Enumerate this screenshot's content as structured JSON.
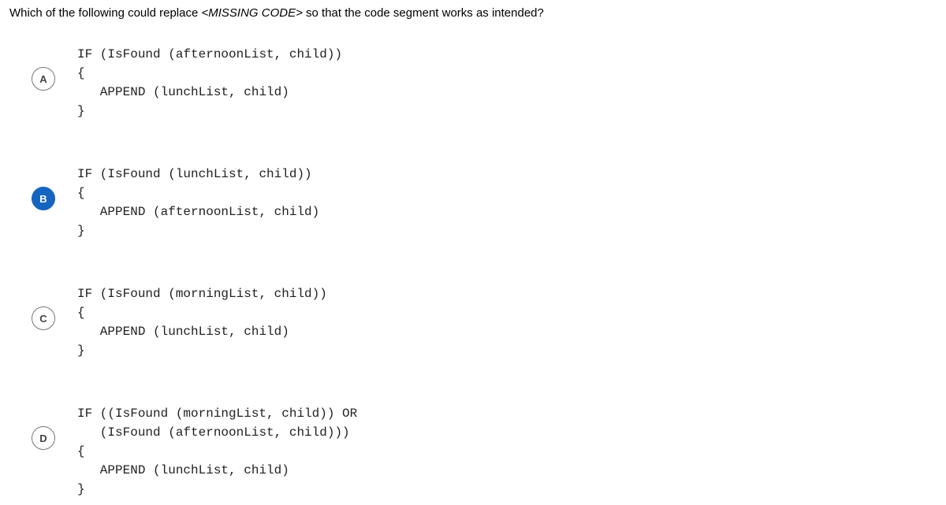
{
  "question_prefix": "Which of the following could replace ",
  "question_code": "<MISSING CODE>",
  "question_suffix": " so that the code segment works as intended?",
  "options": [
    {
      "letter": "A",
      "selected": false,
      "code": "IF (IsFound (afternoonList, child))\n{\n   APPEND (lunchList, child)\n}"
    },
    {
      "letter": "B",
      "selected": true,
      "code": "IF (IsFound (lunchList, child))\n{\n   APPEND (afternoonList, child)\n}"
    },
    {
      "letter": "C",
      "selected": false,
      "code": "IF (IsFound (morningList, child))\n{\n   APPEND (lunchList, child)\n}"
    },
    {
      "letter": "D",
      "selected": false,
      "code": "IF ((IsFound (morningList, child)) OR\n   (IsFound (afternoonList, child)))\n{\n   APPEND (lunchList, child)\n}"
    }
  ]
}
